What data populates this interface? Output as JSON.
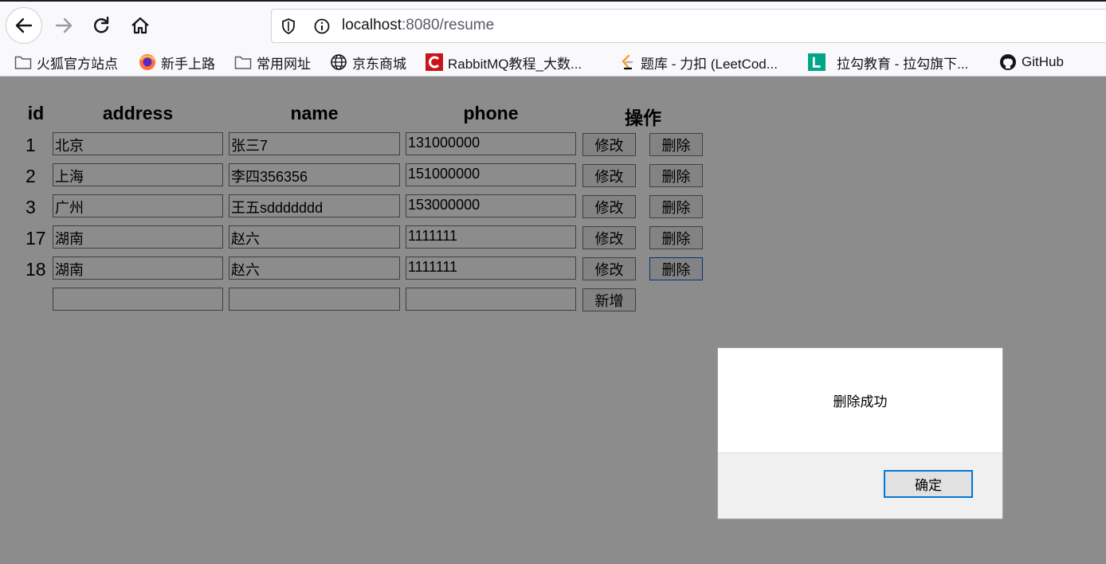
{
  "browser": {
    "url_host": "localhost",
    "url_rest": ":8080/resume",
    "bookmarks": [
      {
        "label": "火狐官方站点",
        "icon": "folder-icon"
      },
      {
        "label": "新手上路",
        "icon": "firefox-icon"
      },
      {
        "label": "常用网址",
        "icon": "folder-icon"
      },
      {
        "label": "京东商城",
        "icon": "globe-icon"
      },
      {
        "label": "RabbitMQ教程_大数...",
        "icon": "csdn-icon"
      },
      {
        "label": "题库 - 力扣 (LeetCod...",
        "icon": "leetcode-icon"
      },
      {
        "label": "拉勾教育 - 拉勾旗下...",
        "icon": "lagou-icon"
      },
      {
        "label": "GitHub",
        "icon": "github-icon"
      }
    ]
  },
  "table": {
    "headers": {
      "id": "id",
      "address": "address",
      "name": "name",
      "phone": "phone",
      "actions": "操作"
    },
    "rows": [
      {
        "id": "1",
        "address": "北京",
        "name": "张三7",
        "phone": "131000000"
      },
      {
        "id": "2",
        "address": "上海",
        "name": "李四356356",
        "phone": "151000000"
      },
      {
        "id": "3",
        "address": "广州",
        "name": "王五sddddddd",
        "phone": "153000000"
      },
      {
        "id": "17",
        "address": "湖南",
        "name": "赵六",
        "phone": "1111111"
      },
      {
        "id": "18",
        "address": "湖南",
        "name": "赵六",
        "phone": "1111111"
      }
    ],
    "edit_label": "修改",
    "delete_label": "删除",
    "add_label": "新增",
    "new_row": {
      "address": "",
      "name": "",
      "phone": ""
    }
  },
  "dialog": {
    "message": "删除成功",
    "ok_label": "确定"
  },
  "colors": {
    "overlay": "rgba(0,0,0,0.45)",
    "focus_border": "#0078d7"
  }
}
